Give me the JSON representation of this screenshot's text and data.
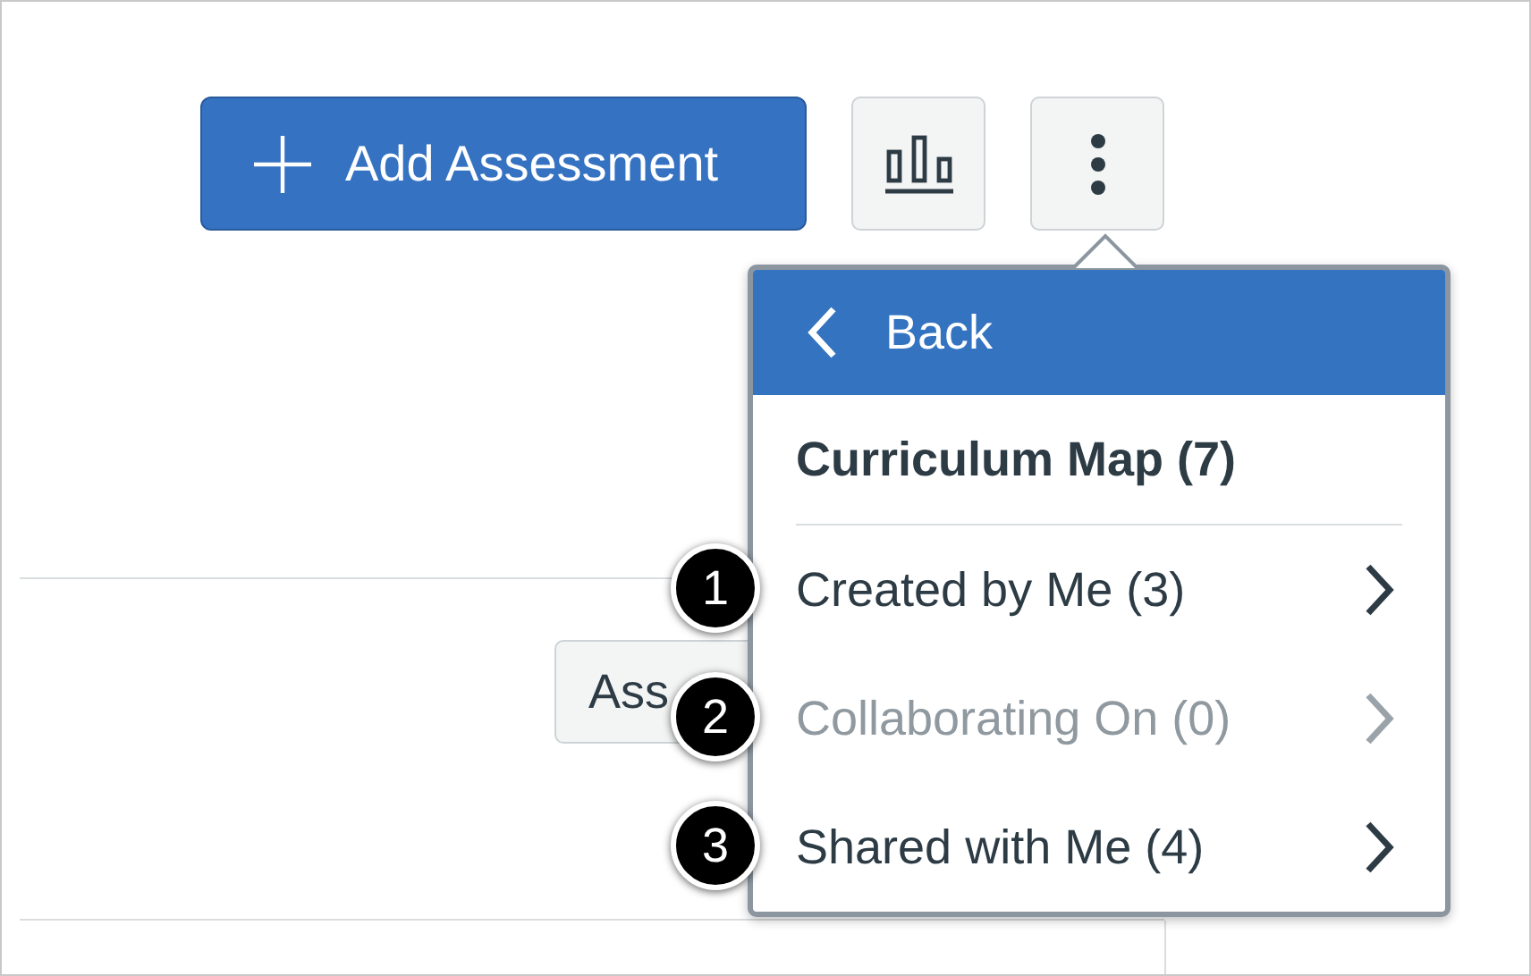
{
  "toolbar": {
    "add_button": {
      "label": "Add Assessment"
    }
  },
  "partial_button": {
    "label": "Ass"
  },
  "menu": {
    "back": {
      "label": "Back"
    },
    "title": "Curriculum Map (7)",
    "items": [
      {
        "label": "Created by Me (3)",
        "disabled": false,
        "callout": "1"
      },
      {
        "label": "Collaborating On (0)",
        "disabled": true,
        "callout": "2"
      },
      {
        "label": "Shared with Me (4)",
        "disabled": false,
        "callout": "3"
      }
    ]
  }
}
